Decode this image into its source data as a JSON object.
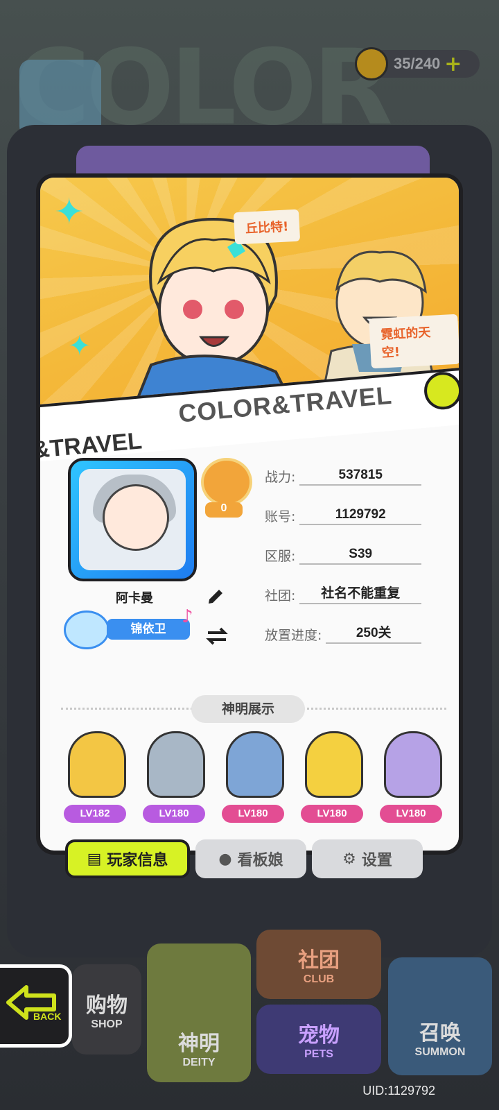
{
  "hud": {
    "stamina": "35/240"
  },
  "banner": {
    "speech1": "丘比特!",
    "speech2": "霓虹的天空!",
    "ribbon_main": "COLOR&TRAVEL",
    "ribbon_sub": "&TRAVEL"
  },
  "profile": {
    "rank_count": "0",
    "name": "阿卡曼",
    "title": "锦依卫",
    "stats": [
      {
        "label": "战力:",
        "value": "537815"
      },
      {
        "label": "账号:",
        "value": "1129792"
      },
      {
        "label": "区服:",
        "value": "S39"
      },
      {
        "label": "社团:",
        "value": "社名不能重复"
      },
      {
        "label": "放置进度:",
        "value": "250关"
      }
    ]
  },
  "deity_section": {
    "title": "神明展示",
    "deities": [
      {
        "level": "LV182",
        "color": "#f3c644",
        "badge_color": "#b85be0"
      },
      {
        "level": "LV180",
        "color": "#a8b7c6",
        "badge_color": "#b85be0"
      },
      {
        "level": "LV180",
        "color": "#7ea5d6",
        "badge_color": "#e34d93"
      },
      {
        "level": "LV180",
        "color": "#f4d040",
        "badge_color": "#e34d93"
      },
      {
        "level": "LV180",
        "color": "#b6a2e6",
        "badge_color": "#e34d93"
      }
    ]
  },
  "tabs": {
    "info": "玩家信息",
    "waifu": "看板娘",
    "settings": "设置"
  },
  "bottom_nav": {
    "shop_zh": "购物",
    "shop_en": "SHOP",
    "deity_zh": "神明",
    "deity_en": "DEITY",
    "club_zh": "社团",
    "club_en": "CLUB",
    "pets_zh": "宠物",
    "pets_en": "PETS",
    "summon_zh": "召唤",
    "summon_en": "SUMMON",
    "back": "BACK"
  },
  "uid": "UID:1129792"
}
